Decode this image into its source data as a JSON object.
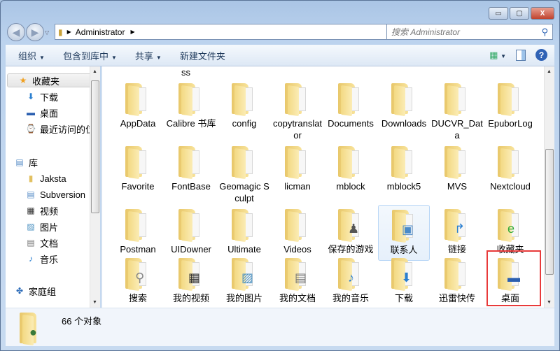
{
  "window": {
    "minimize": "▭",
    "maximize": "▢",
    "close": "X"
  },
  "address": {
    "path": [
      "Administrator"
    ],
    "search_placeholder": "搜索 Administrator"
  },
  "toolbar": {
    "organize": "组织",
    "include": "包含到库中",
    "share": "共享",
    "new_folder": "新建文件夹"
  },
  "sidebar": {
    "items": [
      {
        "label": "收藏夹",
        "icon": "star-icon",
        "level": 0
      },
      {
        "label": "下载",
        "icon": "download-folder-icon",
        "level": 1
      },
      {
        "label": "桌面",
        "icon": "desktop-icon",
        "level": 1
      },
      {
        "label": "最近访问的位置",
        "icon": "recent-places-icon",
        "level": 1
      },
      {
        "label": "库",
        "icon": "library-icon",
        "level": 0
      },
      {
        "label": "Jaksta",
        "icon": "folder-icon",
        "level": 1
      },
      {
        "label": "Subversion",
        "icon": "library-icon",
        "level": 1
      },
      {
        "label": "视频",
        "icon": "video-icon",
        "level": 1
      },
      {
        "label": "图片",
        "icon": "picture-icon",
        "level": 1
      },
      {
        "label": "文档",
        "icon": "document-icon",
        "level": 1
      },
      {
        "label": "音乐",
        "icon": "music-icon",
        "level": 1
      },
      {
        "label": "家庭组",
        "icon": "homegroup-icon",
        "level": 0
      }
    ]
  },
  "partial_label": "ss",
  "items": [
    {
      "label": "AppData"
    },
    {
      "label": "Calibre 书库"
    },
    {
      "label": "config"
    },
    {
      "label": "copytranslator"
    },
    {
      "label": "Documents"
    },
    {
      "label": "Downloads"
    },
    {
      "label": "DUCVR_Data"
    },
    {
      "label": "EpuborLog"
    },
    {
      "label": "Favorite"
    },
    {
      "label": "FontBase"
    },
    {
      "label": "Geomagic Sculpt"
    },
    {
      "label": "licman"
    },
    {
      "label": "mblock"
    },
    {
      "label": "mblock5"
    },
    {
      "label": "MVS"
    },
    {
      "label": "Nextcloud"
    },
    {
      "label": "Postman"
    },
    {
      "label": "UIDowner"
    },
    {
      "label": "Ultimate"
    },
    {
      "label": "Videos"
    },
    {
      "label": "保存的游戏",
      "icon": "chess-icon"
    },
    {
      "label": "联系人",
      "icon": "contacts-icon",
      "hover": true
    },
    {
      "label": "链接",
      "icon": "link-arrow-icon"
    },
    {
      "label": "收藏夹",
      "icon": "ie-favorites-icon"
    },
    {
      "label": "搜索",
      "icon": "magnifier-icon"
    },
    {
      "label": "我的视频",
      "icon": "film-icon"
    },
    {
      "label": "我的图片",
      "icon": "picture-icon"
    },
    {
      "label": "我的文档",
      "icon": "document-icon"
    },
    {
      "label": "我的音乐",
      "icon": "music-icon"
    },
    {
      "label": "下载",
      "icon": "download-arrow-icon"
    },
    {
      "label": "迅雷快传"
    },
    {
      "label": "桌面",
      "icon": "desktop-icon",
      "highlighted": true
    }
  ],
  "status": {
    "count": "66 个对象"
  },
  "colors": {
    "highlight_box": "#e83a3a",
    "frame": "#aac5e5"
  }
}
